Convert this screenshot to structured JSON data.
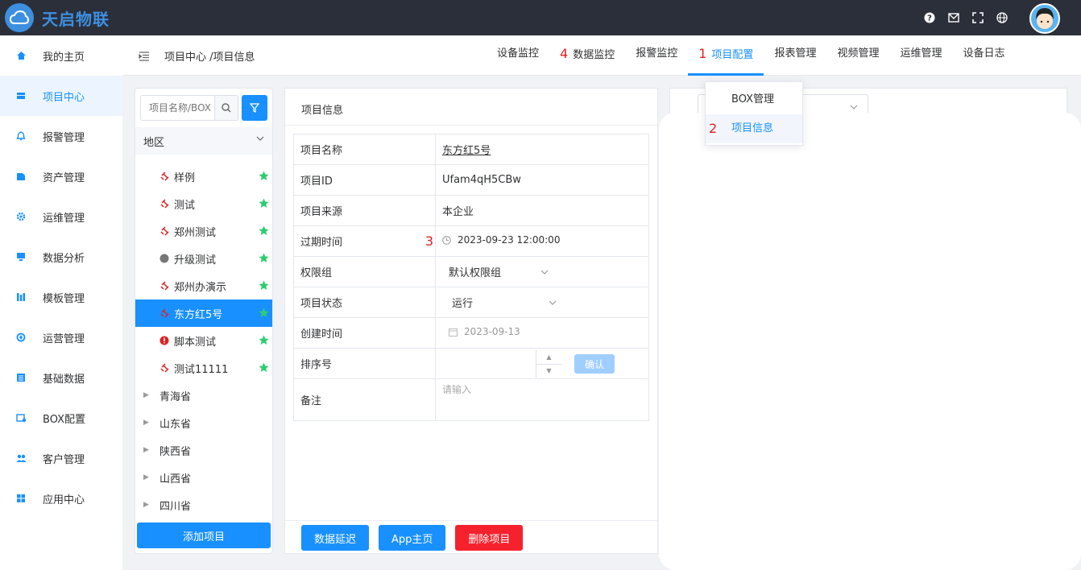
{
  "app": {
    "brand": "天启物联"
  },
  "colors": {
    "accent": "#1890ff",
    "danger": "#f5222d",
    "topbar": "#2b2f3a",
    "star": "#2ecc71"
  },
  "sidebar": {
    "items": [
      {
        "label": "我的主页",
        "icon": "home-icon"
      },
      {
        "label": "项目中心",
        "icon": "project-icon",
        "active": true
      },
      {
        "label": "报警管理",
        "icon": "bell-icon"
      },
      {
        "label": "资产管理",
        "icon": "asset-icon"
      },
      {
        "label": "运维管理",
        "icon": "gear-icon"
      },
      {
        "label": "数据分析",
        "icon": "monitor-icon"
      },
      {
        "label": "模板管理",
        "icon": "template-icon"
      },
      {
        "label": "运营管理",
        "icon": "operation-icon"
      },
      {
        "label": "基础数据",
        "icon": "data-icon"
      },
      {
        "label": "BOX配置",
        "icon": "box-icon"
      },
      {
        "label": "客户管理",
        "icon": "users-icon"
      },
      {
        "label": "应用中心",
        "icon": "apps-icon"
      }
    ]
  },
  "header": {
    "breadcrumb": "项目中心 /项目信息",
    "menu": [
      {
        "label": "设备监控",
        "mark": ""
      },
      {
        "label": "数据监控",
        "mark": "4"
      },
      {
        "label": "报警监控",
        "mark": ""
      },
      {
        "label": "项目配置",
        "mark": "1",
        "active": true
      },
      {
        "label": "报表管理",
        "mark": ""
      },
      {
        "label": "视频管理",
        "mark": ""
      },
      {
        "label": "运维管理",
        "mark": ""
      },
      {
        "label": "设备日志",
        "mark": ""
      }
    ]
  },
  "dropdown": {
    "items": [
      {
        "label": "BOX管理",
        "mark": ""
      },
      {
        "label": "项目信息",
        "mark": "2",
        "active": true
      }
    ]
  },
  "tree": {
    "search_placeholder": "项目名称/BOX",
    "region_label": "地区",
    "projects": [
      {
        "label": "样例",
        "status": "offline"
      },
      {
        "label": "测试",
        "status": "offline"
      },
      {
        "label": "郑州测试",
        "status": "offline"
      },
      {
        "label": "升级测试",
        "status": "unknown"
      },
      {
        "label": "郑州办演示",
        "status": "offline"
      },
      {
        "label": "东方红5号",
        "status": "offline",
        "active": true
      },
      {
        "label": "脚本测试",
        "status": "alarm"
      },
      {
        "label": "测试11111",
        "status": "offline"
      }
    ],
    "provinces": [
      "青海省",
      "山东省",
      "陕西省",
      "山西省",
      "四川省"
    ],
    "add_button": "添加项目"
  },
  "info": {
    "title": "项目信息",
    "rows": {
      "name_label": "项目名称",
      "name_value": "东方红5号",
      "id_label": "项目ID",
      "id_value": "Ufam4qH5CBw",
      "source_label": "项目来源",
      "source_value": "本企业",
      "expire_label": "过期时间",
      "expire_mark": "3",
      "expire_value": "2023-09-23 12:00:00",
      "group_label": "权限组",
      "group_value": "默认权限组",
      "status_label": "项目状态",
      "status_value": "运行",
      "created_label": "创建时间",
      "created_value": "2023-09-13",
      "sort_label": "排序号",
      "confirm_label": "确认",
      "remark_label": "备注",
      "remark_placeholder": "请输入"
    },
    "buttons": {
      "delay": "数据延迟",
      "app_home": "App主页",
      "delete": "删除项目"
    }
  }
}
